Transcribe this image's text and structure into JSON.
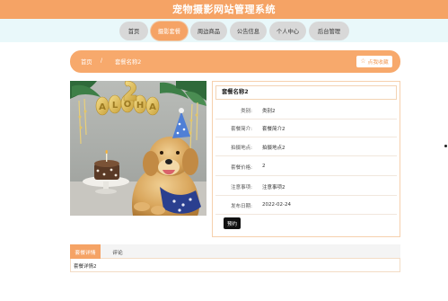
{
  "site": {
    "title": "宠物摄影网站管理系统"
  },
  "nav": {
    "items": [
      {
        "label": "首页"
      },
      {
        "label": "摄影套餐"
      },
      {
        "label": "周边商品"
      },
      {
        "label": "公告信息"
      },
      {
        "label": "个人中心"
      },
      {
        "label": "后台管理"
      }
    ],
    "active_index": 1
  },
  "breadcrumb": {
    "home": "首页",
    "separator": "/",
    "current": "套餐名称2"
  },
  "favorite": {
    "label": "点我收藏",
    "icon": "star-outline-icon"
  },
  "detail": {
    "name": "套餐名称2",
    "fields": [
      {
        "label": "类别:",
        "value": "类别2"
      },
      {
        "label": "套餐简介:",
        "value": "套餐简介2"
      },
      {
        "label": "拍摄地点:",
        "value": "拍摄地点2"
      },
      {
        "label": "套餐价格:",
        "value": "2"
      },
      {
        "label": "注意事项:",
        "value": "注意事项2"
      },
      {
        "label": "发布日期:",
        "value": "2022-02-24"
      }
    ],
    "order_label": "预约"
  },
  "tabs": {
    "items": [
      {
        "label": "套餐详情"
      },
      {
        "label": "评论"
      }
    ],
    "active_index": 0,
    "content": "套餐详情2"
  },
  "photo": {
    "balloon_text": "ALOHA",
    "number_balloon": "3"
  },
  "colors": {
    "accent": "#f5a365",
    "nav_band": "#e9f8fa",
    "nav_pill": "#d8d8d8"
  }
}
